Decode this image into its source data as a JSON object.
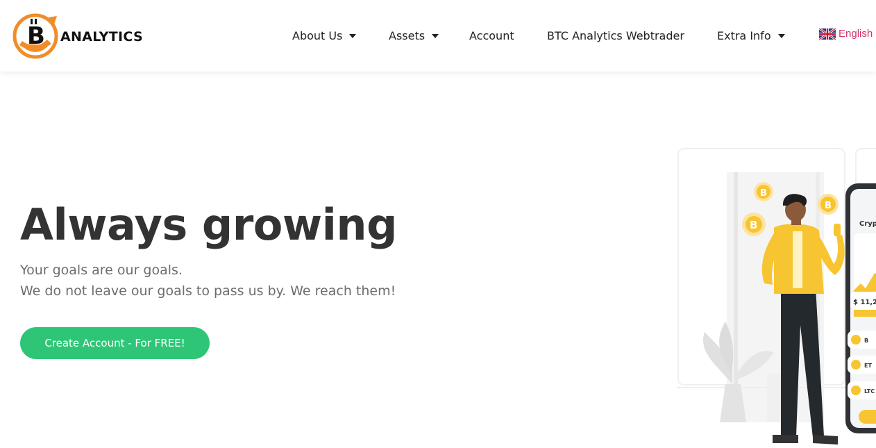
{
  "header": {
    "logo_text": "ANALYTICS",
    "nav": [
      {
        "label": "About Us",
        "has_dropdown": true
      },
      {
        "label": "Assets",
        "has_dropdown": true
      },
      {
        "label": "Account",
        "has_dropdown": false
      },
      {
        "label": "BTC Analytics Webtrader",
        "has_dropdown": false
      },
      {
        "label": "Extra Info",
        "has_dropdown": true
      }
    ],
    "language": {
      "label": "English",
      "flag_icon": "uk-flag-icon"
    }
  },
  "hero": {
    "title": "Always growing",
    "line1": "Your goals are our goals.",
    "line2": "We do not leave our goals to pass us by. We reach them!",
    "cta_label": "Create Account - For FREE!"
  },
  "illustration": {
    "phone_header": "Cryp",
    "price": "$ 11,2",
    "list_items": [
      "B",
      "ET",
      "LTC"
    ],
    "coin_icon": "bitcoin-coin-icon"
  },
  "colors": {
    "brand_orange": "#f28c28",
    "cta_green": "#2ec676",
    "language_link": "#d4306c",
    "coin_yellow": "#f7c531"
  }
}
